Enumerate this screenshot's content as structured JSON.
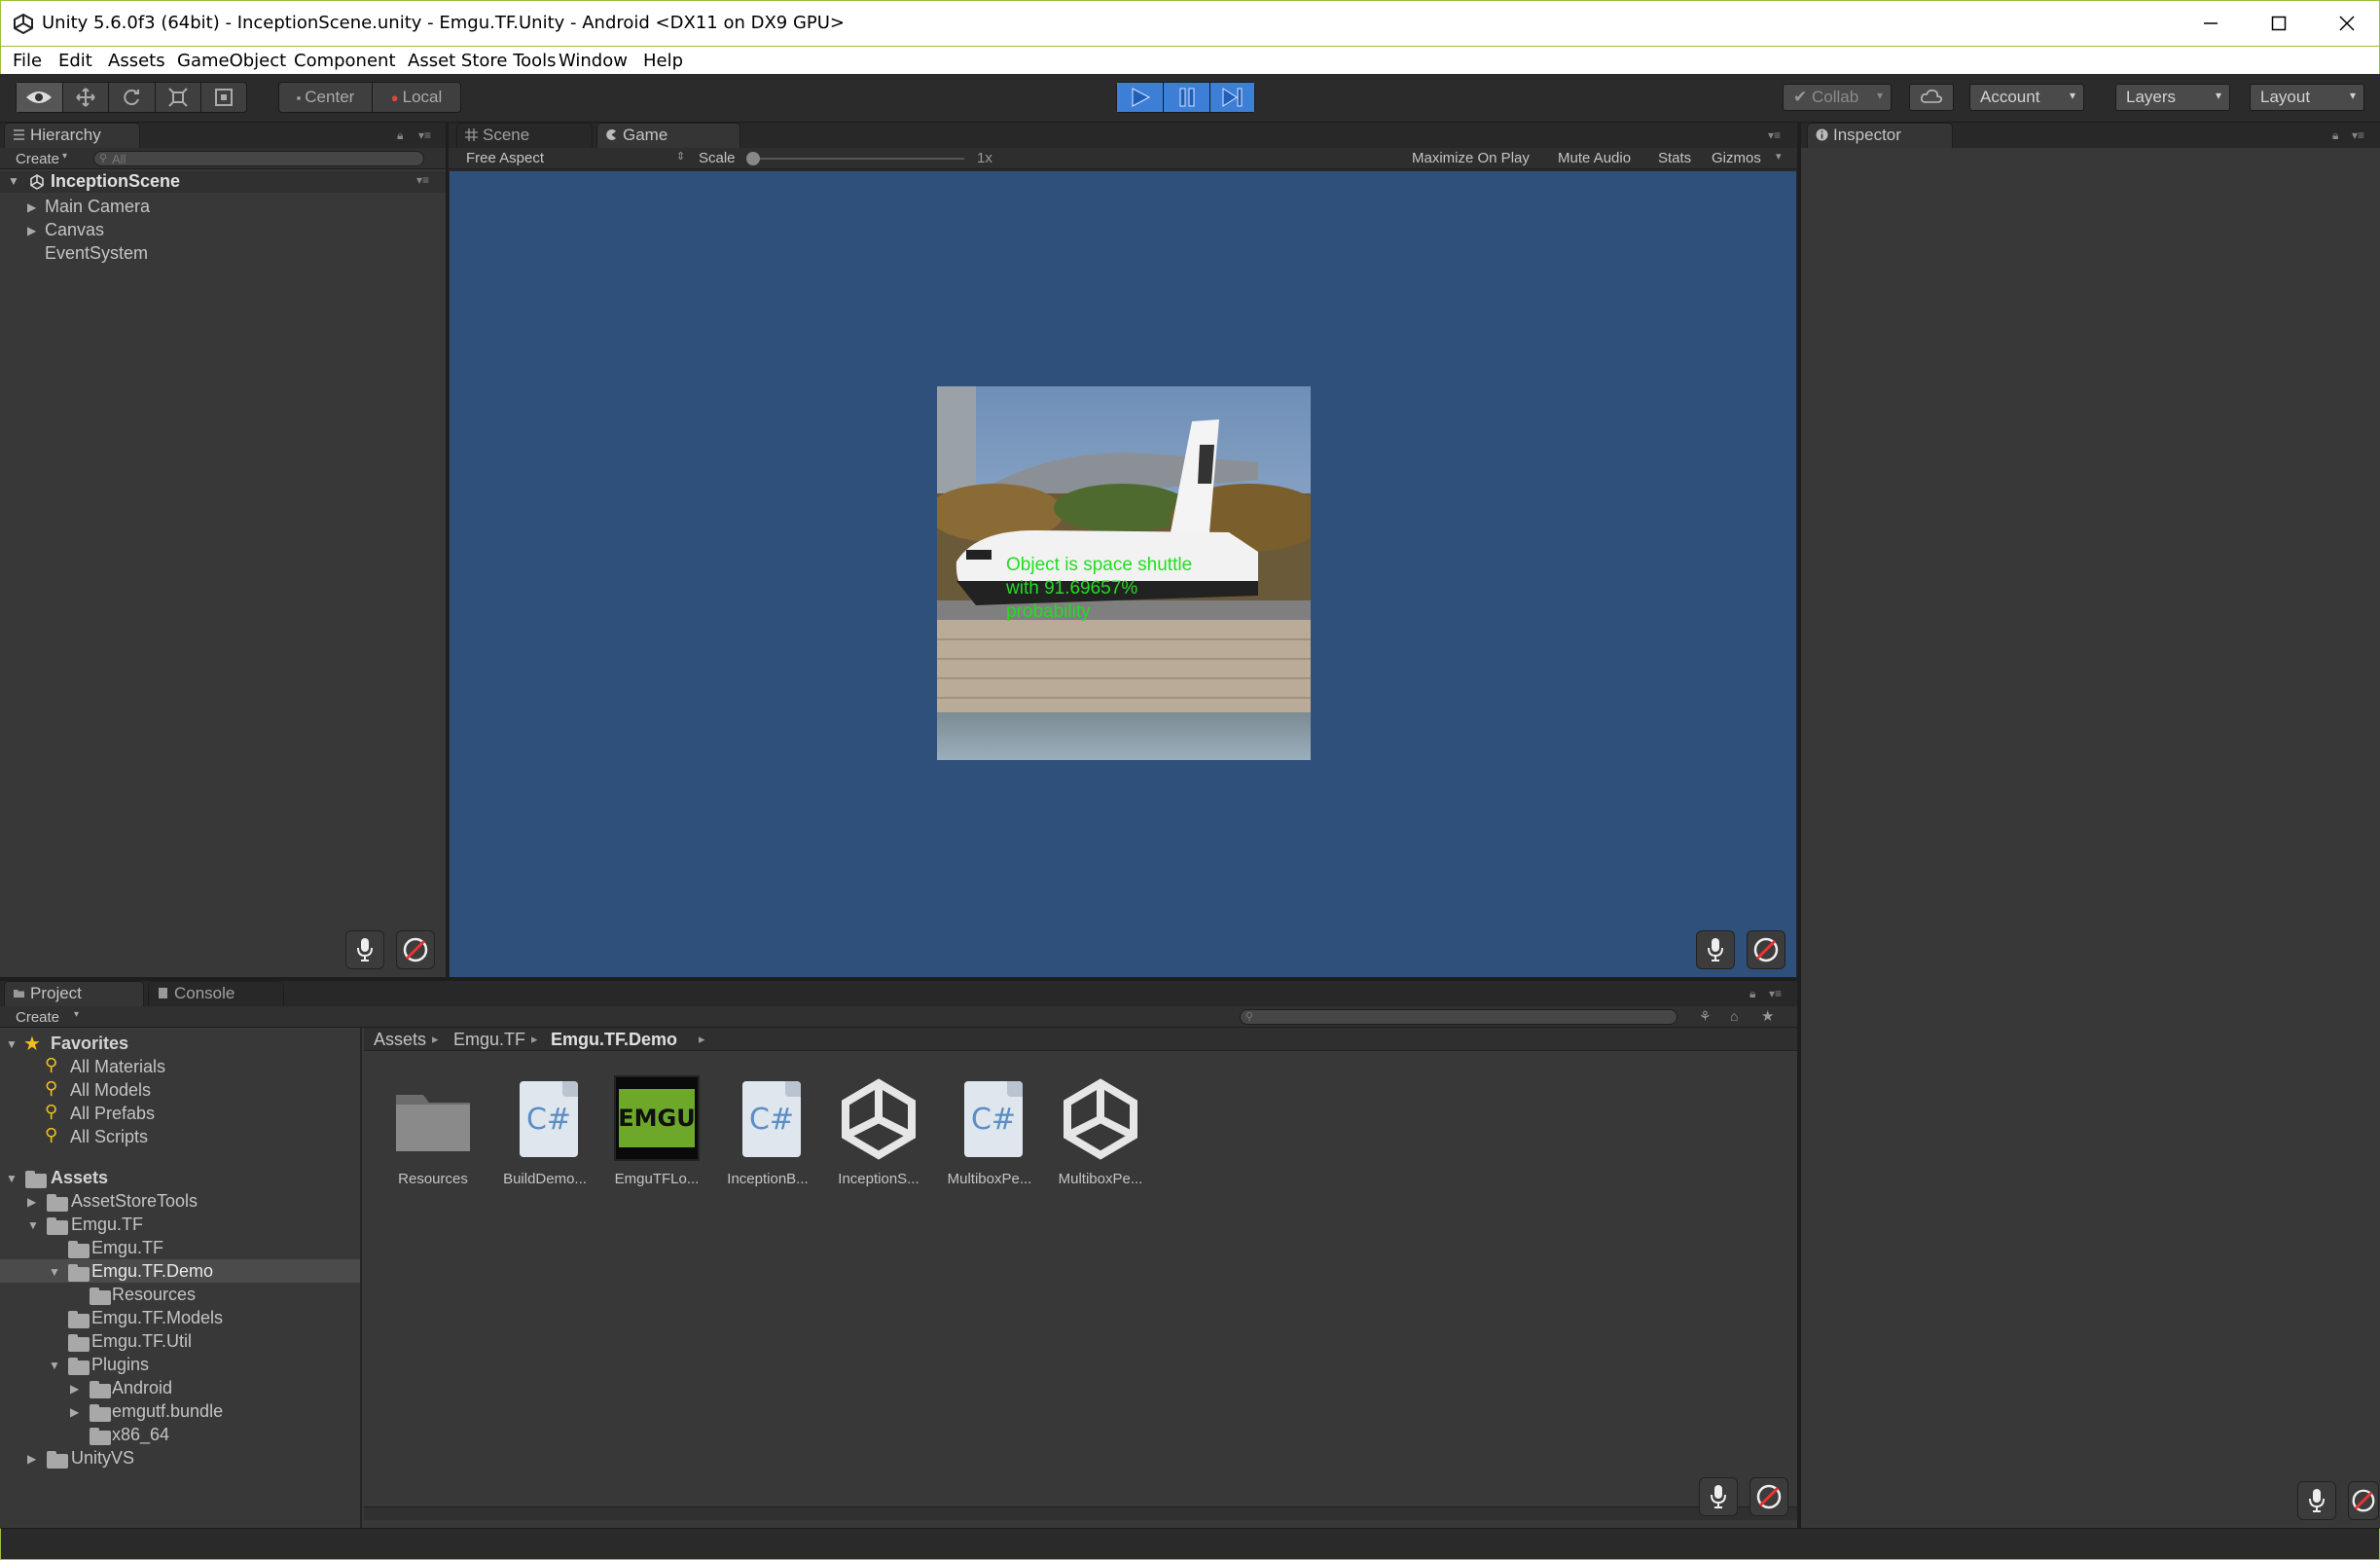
{
  "window": {
    "title": "Unity 5.6.0f3 (64bit) - InceptionScene.unity - Emgu.TF.Unity - Android <DX11 on DX9 GPU>"
  },
  "menu": [
    "File",
    "Edit",
    "Assets",
    "GameObject",
    "Component",
    "Asset Store Tools",
    "Window",
    "Help"
  ],
  "toolbar": {
    "pivot_center": "Center",
    "pivot_local": "Local",
    "collab": "Collab",
    "account": "Account",
    "layers": "Layers",
    "layout": "Layout"
  },
  "hierarchy": {
    "tab": "Hierarchy",
    "create": "Create",
    "search_placeholder": "All",
    "scene": "InceptionScene",
    "items": [
      "Main Camera",
      "Canvas",
      "EventSystem"
    ]
  },
  "game_view": {
    "tab_scene": "Scene",
    "tab_game": "Game",
    "aspect": "Free Aspect",
    "scale_label": "Scale",
    "scale_value": "1x",
    "maximize": "Maximize On Play",
    "mute": "Mute Audio",
    "stats": "Stats",
    "gizmos": "Gizmos",
    "overlay_text": [
      "Object is space shuttle",
      "with 91.69657%",
      "probability"
    ]
  },
  "inspector": {
    "tab": "Inspector"
  },
  "project": {
    "tab_project": "Project",
    "tab_console": "Console",
    "create": "Create",
    "favorites_label": "Favorites",
    "favorites": [
      "All Materials",
      "All Models",
      "All Prefabs",
      "All Scripts"
    ],
    "assets_label": "Assets",
    "tree": [
      "AssetStoreTools",
      "Emgu.TF",
      "Emgu.TF",
      "Emgu.TF.Demo",
      "Resources",
      "Emgu.TF.Models",
      "Emgu.TF.Util",
      "Plugins",
      "Android",
      "emgutf.bundle",
      "x86_64",
      "UnityVS"
    ],
    "breadcrumb": [
      "Assets",
      "Emgu.TF",
      "Emgu.TF.Demo"
    ],
    "files": [
      "Resources",
      "BuildDemo...",
      "EmguTFLo...",
      "InceptionB...",
      "InceptionS...",
      "MultiboxPe...",
      "MultiboxPe..."
    ],
    "emgu_logo_text": "EMGU"
  },
  "colors": {
    "game_bg": "#30507c",
    "play_active": "#3d7fd6",
    "overlay_text": "#22dd22"
  }
}
